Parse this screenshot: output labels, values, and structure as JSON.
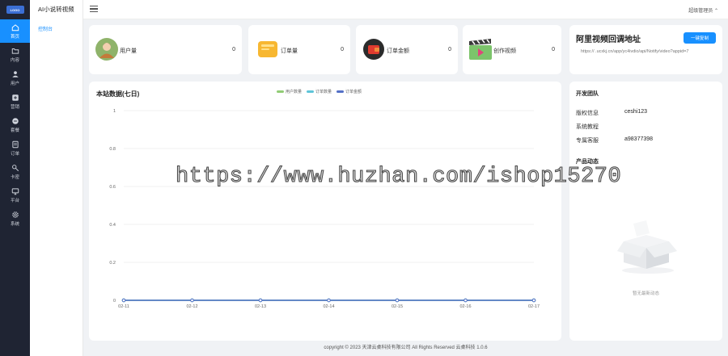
{
  "app": {
    "title": "AI小说转视频"
  },
  "rail": {
    "items": [
      {
        "label": "首页",
        "icon": "home-icon",
        "active": true
      },
      {
        "label": "内容",
        "icon": "folder-icon",
        "active": false
      },
      {
        "label": "用户",
        "icon": "user-icon",
        "active": false
      },
      {
        "label": "营销",
        "icon": "marketing-icon",
        "active": false
      },
      {
        "label": "套餐",
        "icon": "package-icon",
        "active": false
      },
      {
        "label": "订单",
        "icon": "order-icon",
        "active": false
      },
      {
        "label": "卡密",
        "icon": "key-icon",
        "active": false
      },
      {
        "label": "平台",
        "icon": "monitor-icon",
        "active": false
      },
      {
        "label": "系统",
        "icon": "gear-icon",
        "active": false
      }
    ]
  },
  "submenu": {
    "items": [
      "控制台"
    ]
  },
  "topbar": {
    "user": "超级管理员"
  },
  "stats": [
    {
      "label": "用户量",
      "value": "0",
      "icon": "avatar-icon"
    },
    {
      "label": "订单量",
      "value": "0",
      "icon": "wallet-card-icon"
    },
    {
      "label": "订单金额",
      "value": "0",
      "icon": "wallet-icon"
    },
    {
      "label": "创作视频",
      "value": "0",
      "icon": "video-clapper-icon"
    }
  ],
  "ali": {
    "title": "阿里视频回调地址",
    "button": "一键复制",
    "url": "https://          .ucxkj.cn/app/yc4ivdio/api/Notify/video?appid=7"
  },
  "chart_panel": {
    "title": "本站数据(七日)"
  },
  "chart_data": {
    "type": "line",
    "categories": [
      "02-11",
      "02-12",
      "02-13",
      "02-14",
      "02-15",
      "02-16",
      "02-17"
    ],
    "series": [
      {
        "name": "用户数量",
        "values": [
          0,
          0,
          0,
          0,
          0,
          0,
          0
        ],
        "color": "#91cc75"
      },
      {
        "name": "订单数量",
        "values": [
          0,
          0,
          0,
          0,
          0,
          0,
          0
        ],
        "color": "#5fc4d8"
      },
      {
        "name": "订单金额",
        "values": [
          0,
          0,
          0,
          0,
          0,
          0,
          0
        ],
        "color": "#5470c6"
      }
    ],
    "yticks": [
      "0",
      "0.2",
      "0.4",
      "0.6",
      "0.8",
      "1"
    ],
    "ylim": [
      0,
      1
    ],
    "grid": true,
    "legend": "top-center"
  },
  "team": {
    "title": "开发团队",
    "rows": [
      {
        "label": "版权信息",
        "value": "ceshi123"
      },
      {
        "label": "系统教程",
        "value": ""
      },
      {
        "label": "专属客服",
        "value": "a98377398"
      }
    ],
    "product_title": "产品动态",
    "empty": "暂无最新动态"
  },
  "footer": {
    "text": "copyright © 2023   天津云桌科技有限公司 All Rights Reserved   云桌科技 1.0.6"
  },
  "watermark": "https://www.huzhan.com/ishop15270"
}
